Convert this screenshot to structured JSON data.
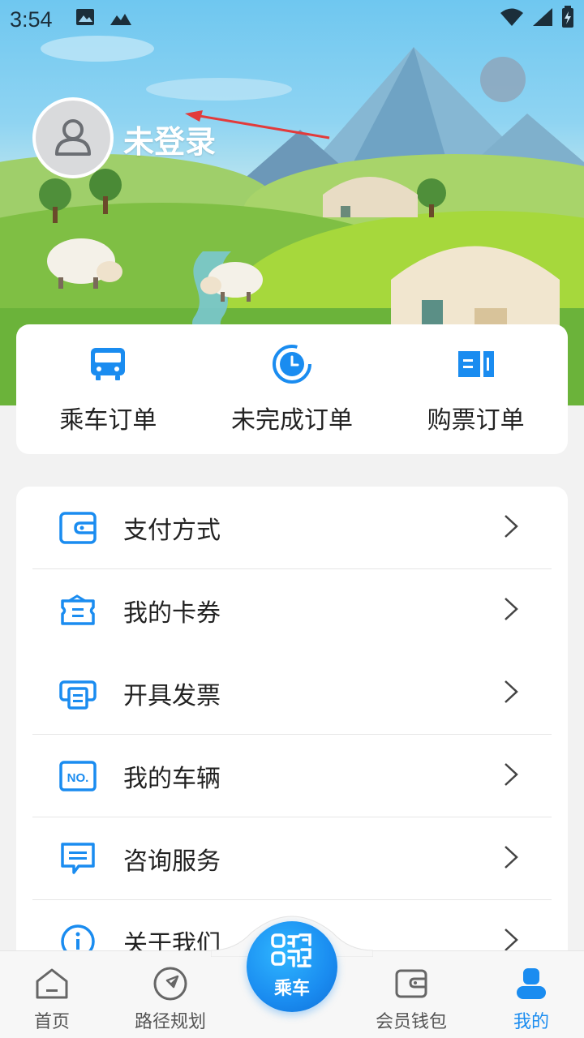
{
  "status_bar": {
    "time": "3:54",
    "icons_left": [
      "image-icon",
      "signal-alt-icon"
    ],
    "icons_right": [
      "wifi-icon",
      "cell-signal-icon",
      "battery-icon"
    ]
  },
  "profile": {
    "avatar_icon": "user-avatar-icon",
    "login_status": "未登录"
  },
  "orders": [
    {
      "label": "乘车订单",
      "icon": "bus-icon"
    },
    {
      "label": "未完成订单",
      "icon": "clock-icon"
    },
    {
      "label": "购票订单",
      "icon": "ticket-icon"
    }
  ],
  "menu": [
    {
      "label": "支付方式",
      "icon": "wallet-icon"
    },
    {
      "label": "我的卡券",
      "icon": "coupon-icon"
    },
    {
      "label": "开具发票",
      "icon": "printer-invoice-icon"
    },
    {
      "label": "我的车辆",
      "icon": "vehicle-plate-icon"
    },
    {
      "label": "咨询服务",
      "icon": "chat-icon"
    },
    {
      "label": "关于我们",
      "icon": "info-icon"
    }
  ],
  "bottom_nav": {
    "items": [
      {
        "label": "首页",
        "icon": "home-icon"
      },
      {
        "label": "路径规划",
        "icon": "navigation-icon"
      },
      {
        "label": "会员钱包",
        "icon": "wallet-icon"
      },
      {
        "label": "我的",
        "icon": "profile-icon",
        "active": true
      }
    ],
    "center_button": {
      "label": "乘车",
      "icon": "qr-code-icon"
    }
  },
  "colors": {
    "accent": "#1a8cf0",
    "annotation_arrow": "#e23b3b"
  }
}
